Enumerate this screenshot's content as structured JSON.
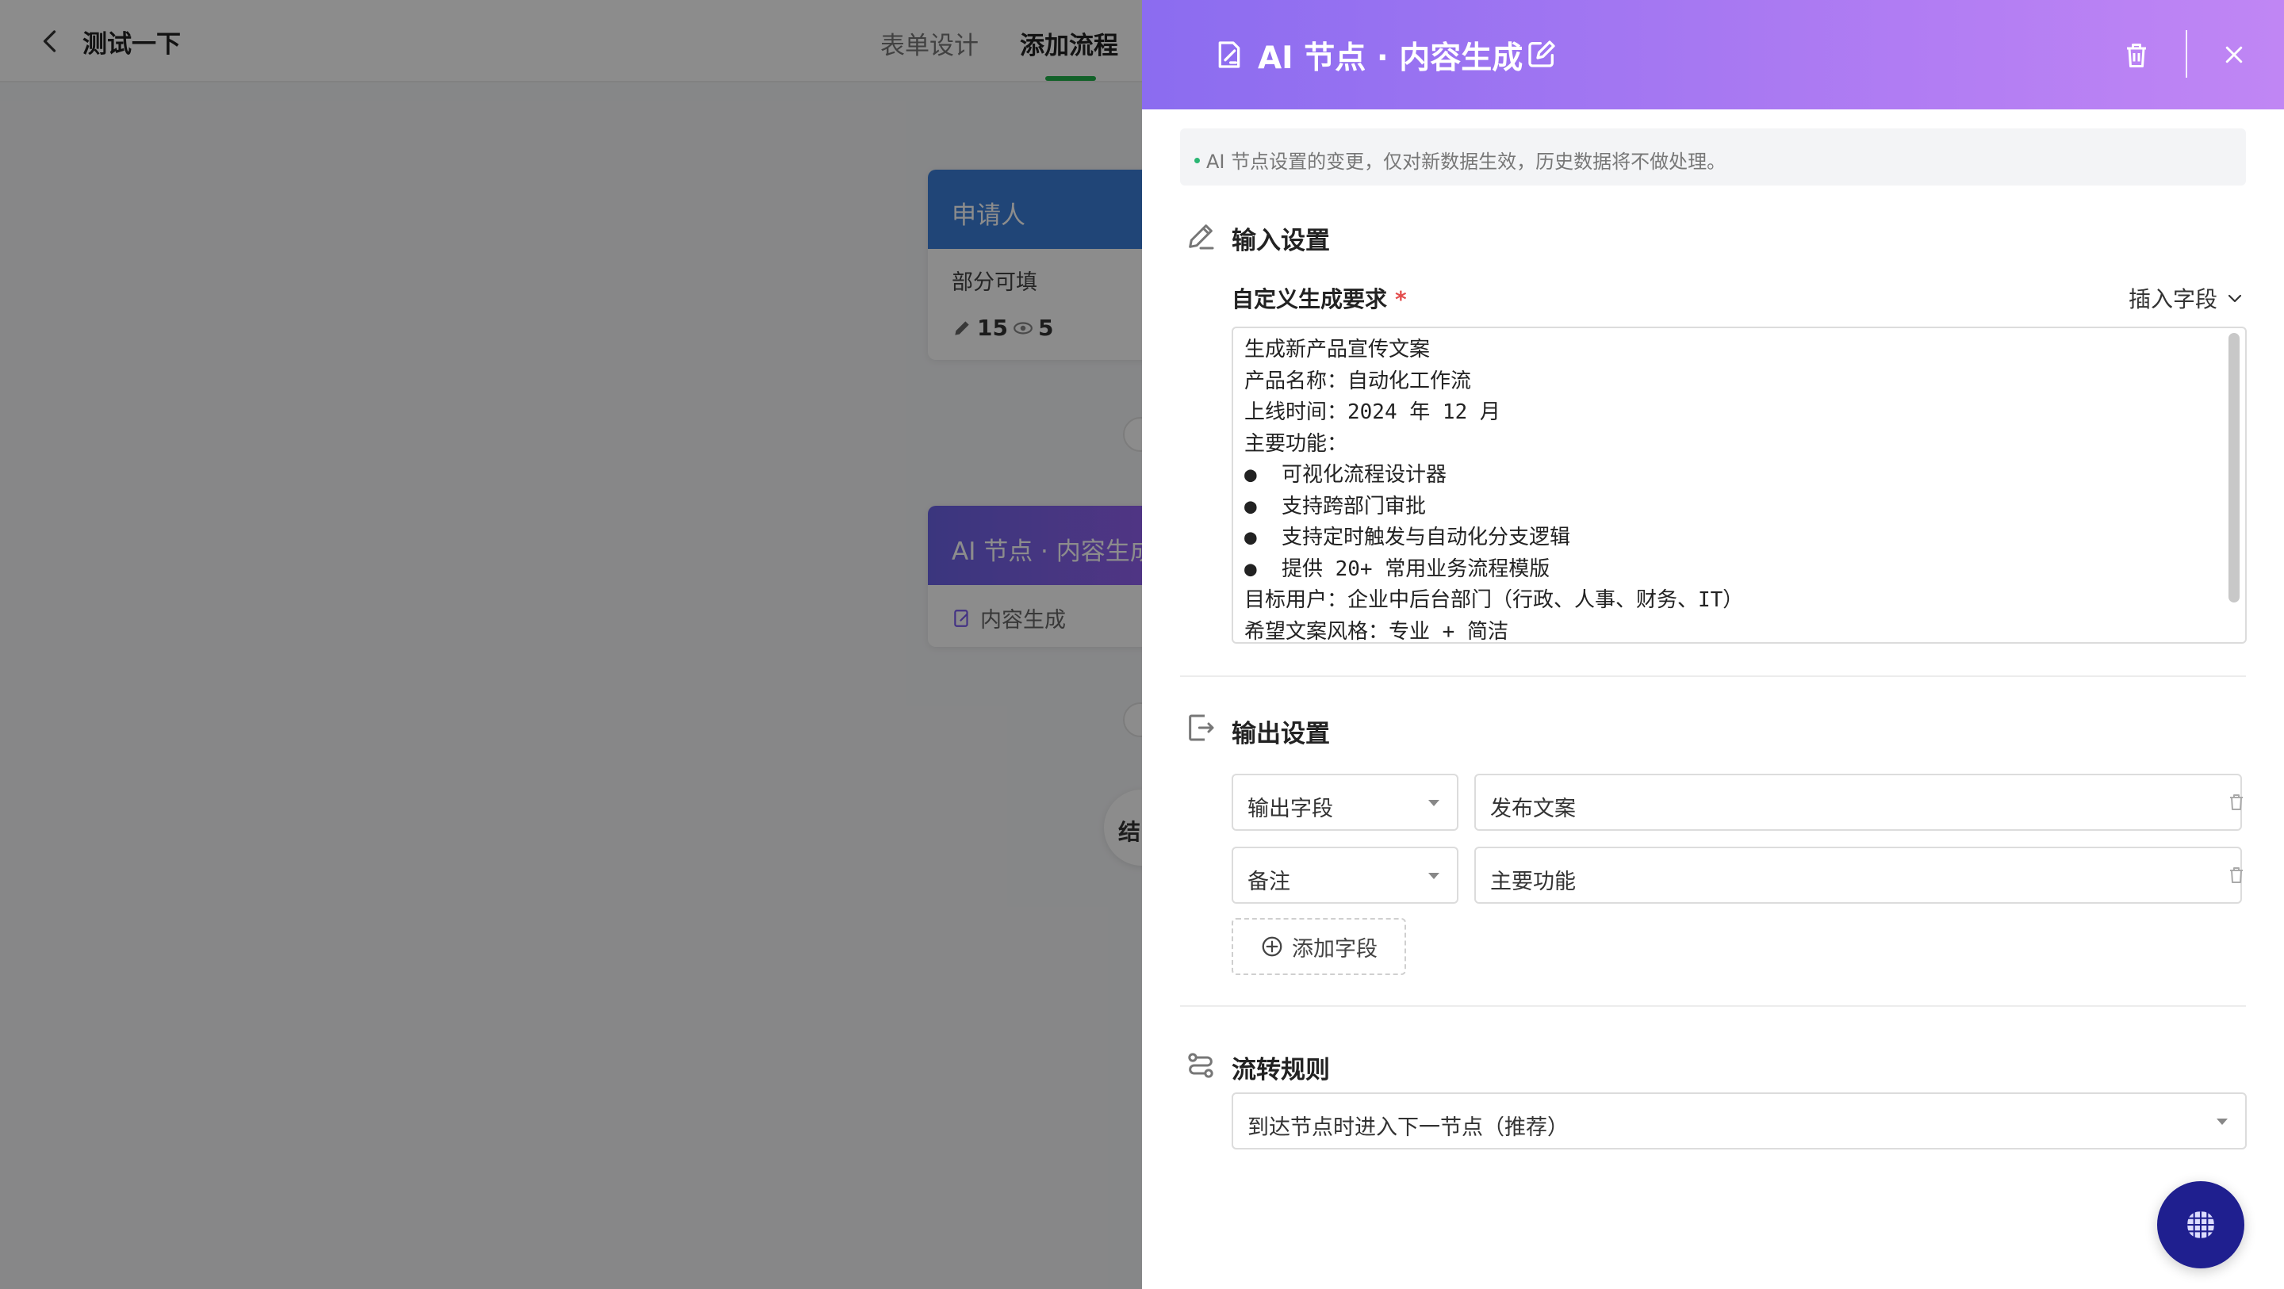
{
  "page": {
    "title": "测试一下",
    "tabs": [
      {
        "label": "表单设计",
        "active": false
      },
      {
        "label": "添加流程",
        "active": true
      }
    ]
  },
  "canvas": {
    "applicant_node": {
      "title": "申请人",
      "subtitle": "部分可填",
      "edit_count": "15",
      "view_count": "5"
    },
    "ai_node": {
      "title": "AI 节点 · 内容生成",
      "subtitle": "内容生成"
    },
    "end_node": {
      "label": "结"
    }
  },
  "drawer": {
    "title": "AI 节点 · 内容生成",
    "notice": "AI 节点设置的变更，仅对新数据生效，历史数据将不做处理。",
    "input_section": {
      "title": "输入设置",
      "field_label": "自定义生成要求",
      "required_mark": "*",
      "insert_field_label": "插入字段",
      "prompt_lines": [
        "生成新产品宣传文案",
        "产品名称：自动化工作流",
        "上线时间：2024 年 12 月",
        "主要功能：",
        "●  可视化流程设计器",
        "●  支持跨部门审批",
        "●  支持定时触发与自动化分支逻辑",
        "●  提供 20+ 常用业务流程模版",
        "目标用户：企业中后台部门（行政、人事、财务、IT）",
        "希望文案风格：专业 + 简洁"
      ]
    },
    "output_section": {
      "title": "输出设置",
      "rows": [
        {
          "field": "输出字段",
          "value": "发布文案"
        },
        {
          "field": "备注",
          "value": "主要功能"
        }
      ],
      "add_field_label": "添加字段"
    },
    "flow_section": {
      "title": "流转规则",
      "selected": "到达节点时进入下一节点（推荐）"
    }
  },
  "colors": {
    "header_gradient_start": "#8b6cf0",
    "header_gradient_end": "#c086f4",
    "tab_active_underline": "#22b14c",
    "required": "#e34d4d",
    "applicant_head": "#3b7fd9",
    "assistant_button": "#1f1f8f"
  }
}
